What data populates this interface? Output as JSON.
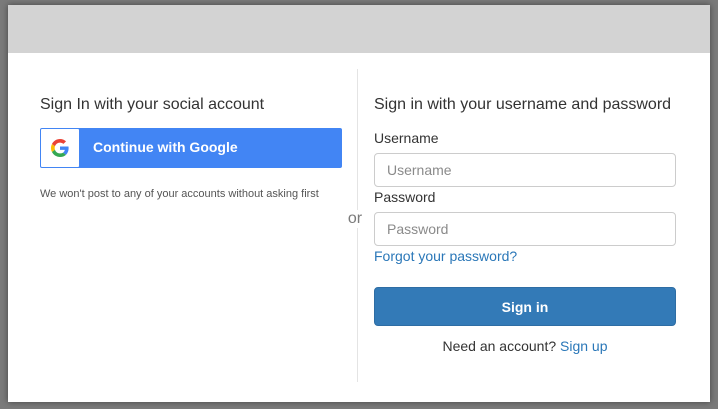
{
  "social": {
    "title": "Sign In with your social account",
    "google_button_label": "Continue with Google",
    "note": "We won't post to any of your accounts without asking first"
  },
  "separator": {
    "label": "or"
  },
  "credentials": {
    "title": "Sign in with your username and password",
    "username_label": "Username",
    "username_placeholder": "Username",
    "username_value": "",
    "password_label": "Password",
    "password_placeholder": "Password",
    "password_value": "",
    "forgot_link": "Forgot your password?",
    "signin_button": "Sign in",
    "signup_prompt": "Need an account?",
    "signup_link": "Sign up"
  },
  "colors": {
    "google_blue": "#4285f4",
    "primary_button": "#337ab7",
    "link": "#2a77b8",
    "banner": "#d3d3d3"
  },
  "icons": {
    "google": "google-g-logo-icon"
  }
}
